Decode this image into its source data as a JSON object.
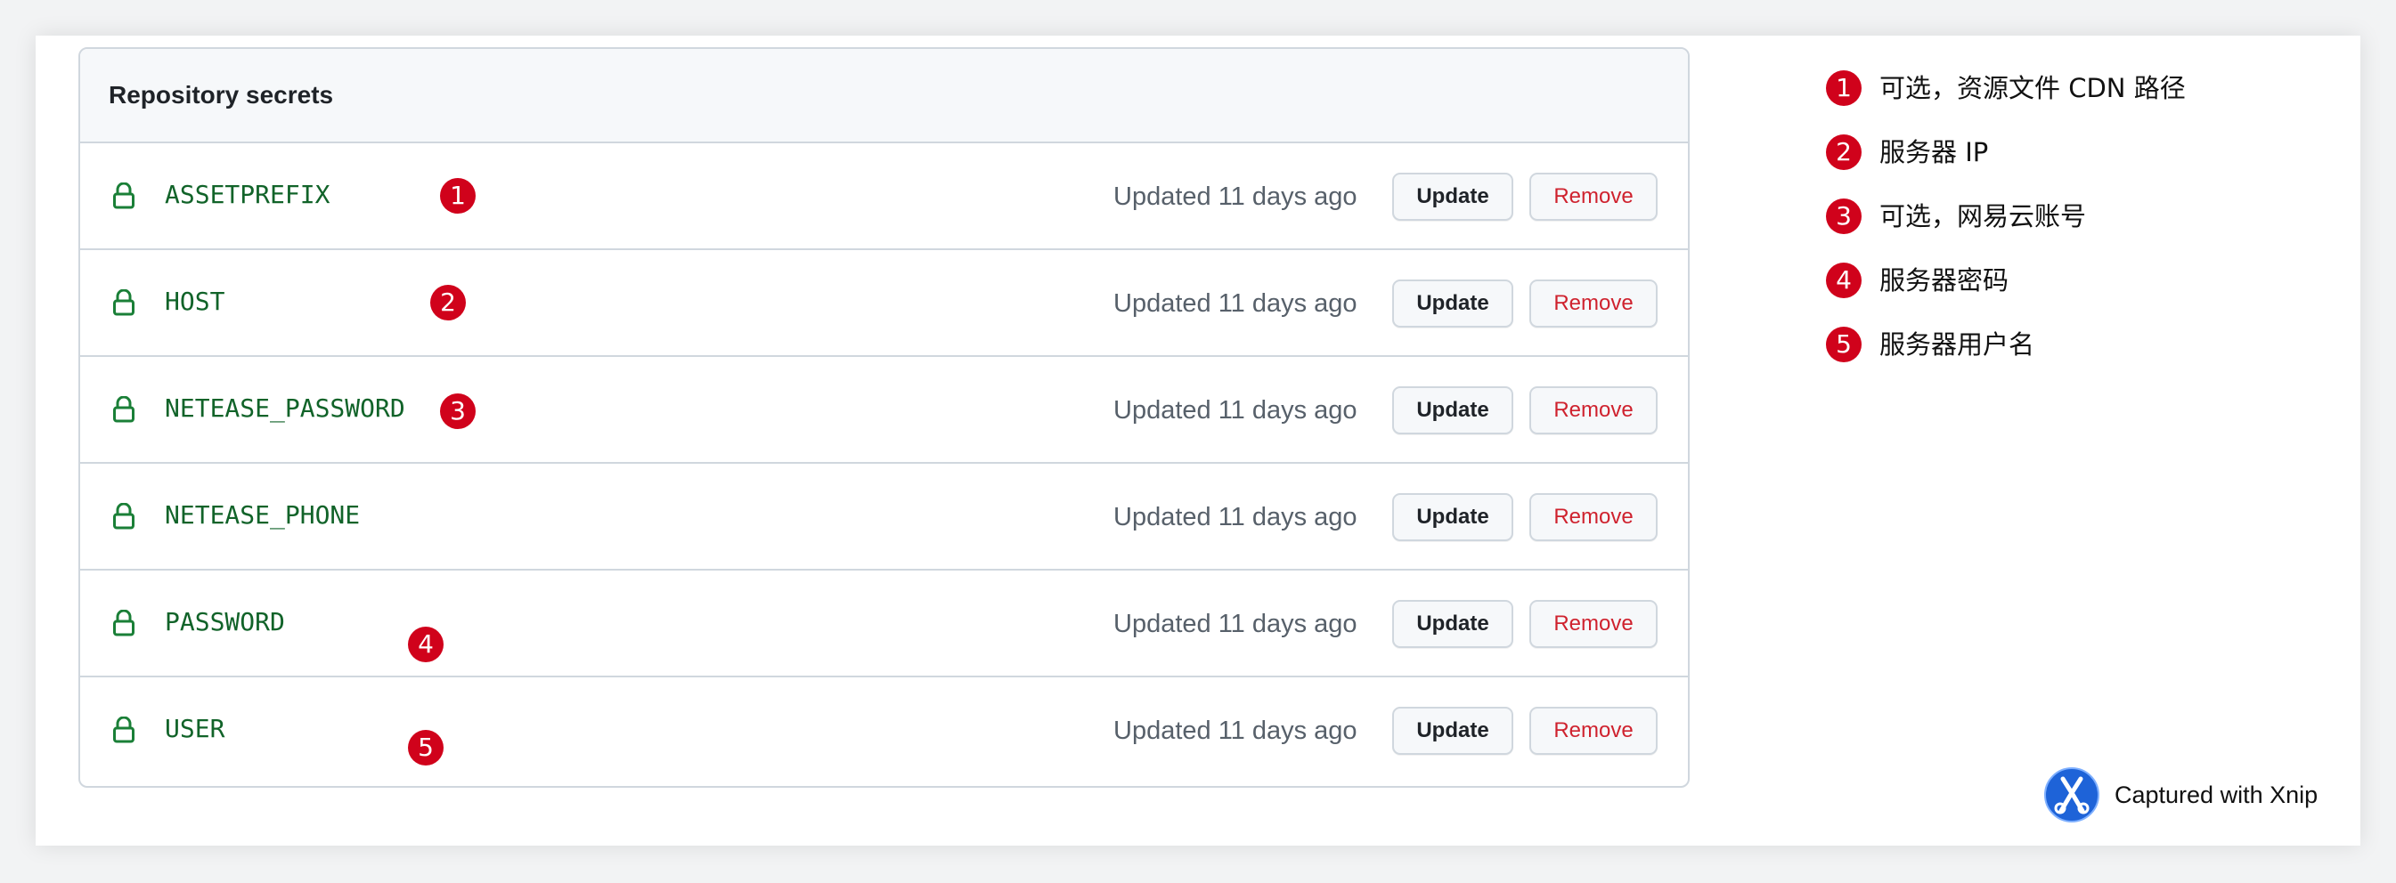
{
  "header": {
    "title": "Repository secrets"
  },
  "secrets": [
    {
      "name": "ASSETPREFIX",
      "updated": "Updated 11 days ago",
      "update_label": "Update",
      "remove_label": "Remove",
      "marker": "1"
    },
    {
      "name": "HOST",
      "updated": "Updated 11 days ago",
      "update_label": "Update",
      "remove_label": "Remove",
      "marker": "2"
    },
    {
      "name": "NETEASE_PASSWORD",
      "updated": "Updated 11 days ago",
      "update_label": "Update",
      "remove_label": "Remove",
      "marker": "3"
    },
    {
      "name": "NETEASE_PHONE",
      "updated": "Updated 11 days ago",
      "update_label": "Update",
      "remove_label": "Remove",
      "marker": ""
    },
    {
      "name": "PASSWORD",
      "updated": "Updated 11 days ago",
      "update_label": "Update",
      "remove_label": "Remove",
      "marker": "4"
    },
    {
      "name": "USER",
      "updated": "Updated 11 days ago",
      "update_label": "Update",
      "remove_label": "Remove",
      "marker": "5"
    }
  ],
  "legend": [
    {
      "number": "1",
      "text": "可选，资源文件 CDN 路径"
    },
    {
      "number": "2",
      "text": "服务器 IP"
    },
    {
      "number": "3",
      "text": "可选，网易云账号"
    },
    {
      "number": "4",
      "text": "服务器密码"
    },
    {
      "number": "5",
      "text": "服务器用户名"
    }
  ],
  "watermark": {
    "text": "Captured with Xnip"
  },
  "icons": {
    "lock": "lock-icon",
    "logo": "xnip-logo-icon"
  },
  "colors": {
    "marker": "#d0021b",
    "secret_name": "#116329",
    "remove_text": "#cf222e",
    "border": "#d0d7de",
    "header_bg": "#f6f8fa"
  }
}
